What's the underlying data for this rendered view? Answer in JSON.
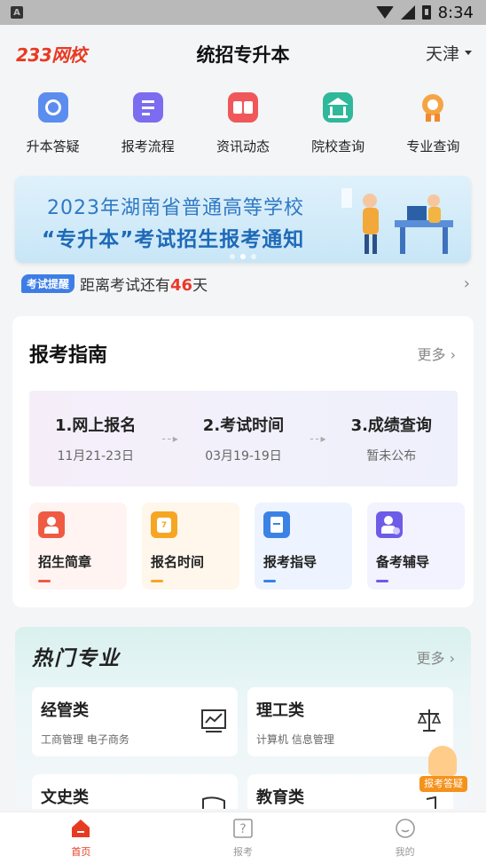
{
  "status_bar": {
    "time": "8:34"
  },
  "header": {
    "logo_text": "233网校",
    "title": "统招专升本",
    "region": "天津"
  },
  "quick_nav": [
    {
      "label": "升本答疑",
      "icon": "qa-icon",
      "color": "#5b8def"
    },
    {
      "label": "报考流程",
      "icon": "process-icon",
      "color": "#7b6cf0"
    },
    {
      "label": "资讯动态",
      "icon": "news-icon",
      "color": "#f0575a"
    },
    {
      "label": "院校查询",
      "icon": "school-icon",
      "color": "#2fb89a"
    },
    {
      "label": "专业查询",
      "icon": "medal-icon",
      "color": "#f5a445"
    }
  ],
  "banner": {
    "line1": "2023年湖南省普通高等学校",
    "line2": "“专升本”考试招生报考通知"
  },
  "reminder": {
    "tag": "考试提醒",
    "prefix": "距离考试还有",
    "days": "46",
    "suffix": "天"
  },
  "guide": {
    "title": "报考指南",
    "more": "更多",
    "steps": [
      {
        "title": "1.网上报名",
        "date": "11月21-23日"
      },
      {
        "title": "2.考试时间",
        "date": "03月19-19日"
      },
      {
        "title": "3.成绩查询",
        "date": "暂未公布"
      }
    ],
    "tiles": [
      {
        "label": "招生简章",
        "icon": "admission-icon",
        "color": "#ef5a43",
        "bg": "#fff4f2"
      },
      {
        "label": "报名时间",
        "icon": "calendar-icon",
        "color": "#f6a623",
        "bg": "#fff6ec"
      },
      {
        "label": "报考指导",
        "icon": "guide-icon",
        "color": "#3b82e6",
        "bg": "#edf4ff"
      },
      {
        "label": "备考辅导",
        "icon": "tutor-icon",
        "color": "#6d5ce8",
        "bg": "#f3f2ff"
      }
    ]
  },
  "hot": {
    "title": "热门专业",
    "more": "更多",
    "categories": [
      {
        "name": "经管类",
        "sub": "工商管理 电子商务",
        "icon": "chart-board-icon"
      },
      {
        "name": "理工类",
        "sub": "计算机 信息管理",
        "icon": "scale-icon"
      },
      {
        "name": "文史类",
        "sub": "",
        "icon": "book-icon"
      },
      {
        "name": "教育类",
        "sub": "",
        "icon": "music-icon"
      }
    ]
  },
  "float_button": {
    "label": "报考答疑"
  },
  "tabs": [
    {
      "label": "首页",
      "active": true
    },
    {
      "label": "报考",
      "active": false
    },
    {
      "label": "我的",
      "active": false
    }
  ]
}
